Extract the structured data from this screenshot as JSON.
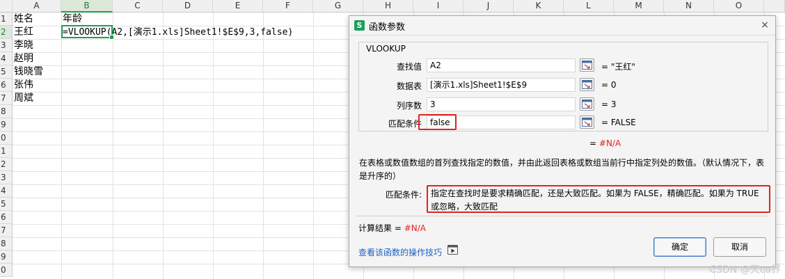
{
  "columns": [
    "A",
    "B",
    "C",
    "D",
    "E",
    "F",
    "G",
    "H",
    "I",
    "J",
    "K",
    "L",
    "M",
    "N",
    "O"
  ],
  "selected_column": "B",
  "rows": [
    "1",
    "2",
    "3",
    "4",
    "5",
    "6",
    "7",
    "8",
    "9",
    "0",
    "1",
    "2",
    "3",
    "4",
    "5",
    "6",
    "7",
    "8",
    "9",
    "0"
  ],
  "selected_row": "2",
  "cells": {
    "A1": "姓名",
    "B1": "年龄",
    "A2": "王红",
    "B2": "=VLOOKUP(A2,[演示1.xls]Sheet1!$E$9,3,false)",
    "A3": "李晓",
    "A4": "赵明",
    "A5": "钱晓雪",
    "A6": "张伟",
    "A7": "周斌"
  },
  "dialog": {
    "icon": "S",
    "title": "函数参数",
    "close": "×",
    "function_name": "VLOOKUP",
    "args": [
      {
        "label": "查找值",
        "value": "A2",
        "result": "= \"王红\""
      },
      {
        "label": "数据表",
        "value": "[演示1.xls]Sheet1!$E$9",
        "result": "= 0"
      },
      {
        "label": "列序数",
        "value": "3",
        "result": "= 3"
      },
      {
        "label": "匹配条件",
        "value": "false",
        "result": "= FALSE"
      }
    ],
    "formula_result_eq": "=",
    "formula_result_val": "#N/A",
    "description": "在表格或数值数组的首列查找指定的数值，并由此返回表格或数组当前行中指定列处的数值。（默认情况下，表是升序的）",
    "arg_desc_label": "匹配条件:",
    "arg_desc": "指定在查找时是要求精确匹配，还是大致匹配。如果为 FALSE，精确匹配。如果为 TRUE 或忽略，大致匹配",
    "calc_label": "计算结果 =",
    "calc_value": "#N/A",
    "help_link": "查看该函数的操作技巧",
    "ok_label": "确定",
    "cancel_label": "取消",
    "highlight_color": "#e0231d"
  },
  "watermark": "CSDN @天ca界"
}
